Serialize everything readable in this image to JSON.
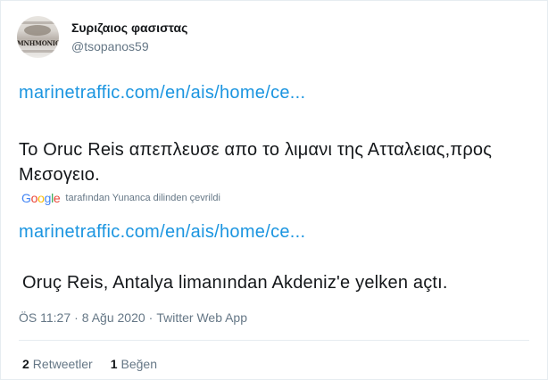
{
  "author": {
    "display_name": "Συριζαιος φασιστας",
    "handle": "@tsopanos59",
    "avatar_text": "MNHMONIC"
  },
  "tweet": {
    "link_original": "marinetraffic.com/en/ais/home/ce...",
    "text_original": "Το Oruc Reis απεπλευσε απο το λιμανι της Ατταλειας,προς Μεσογειο.",
    "translation_provider": "Google",
    "translation_note": "tarafından Yunanca dilinden çevrildi",
    "link_translated": "marinetraffic.com/en/ais/home/ce...",
    "text_translated": "Oruç Reis, Antalya limanından Akdeniz'e yelken açtı."
  },
  "meta": {
    "time": "ÖS 11:27",
    "separator": "·",
    "date": "8 Ağu 2020",
    "source": "Twitter Web App"
  },
  "stats": {
    "retweets_count": "2",
    "retweets_label": "Retweetler",
    "likes_count": "1",
    "likes_label": "Beğen"
  },
  "colors": {
    "link": "#1b95e0",
    "text": "#14171a",
    "muted": "#657786"
  }
}
